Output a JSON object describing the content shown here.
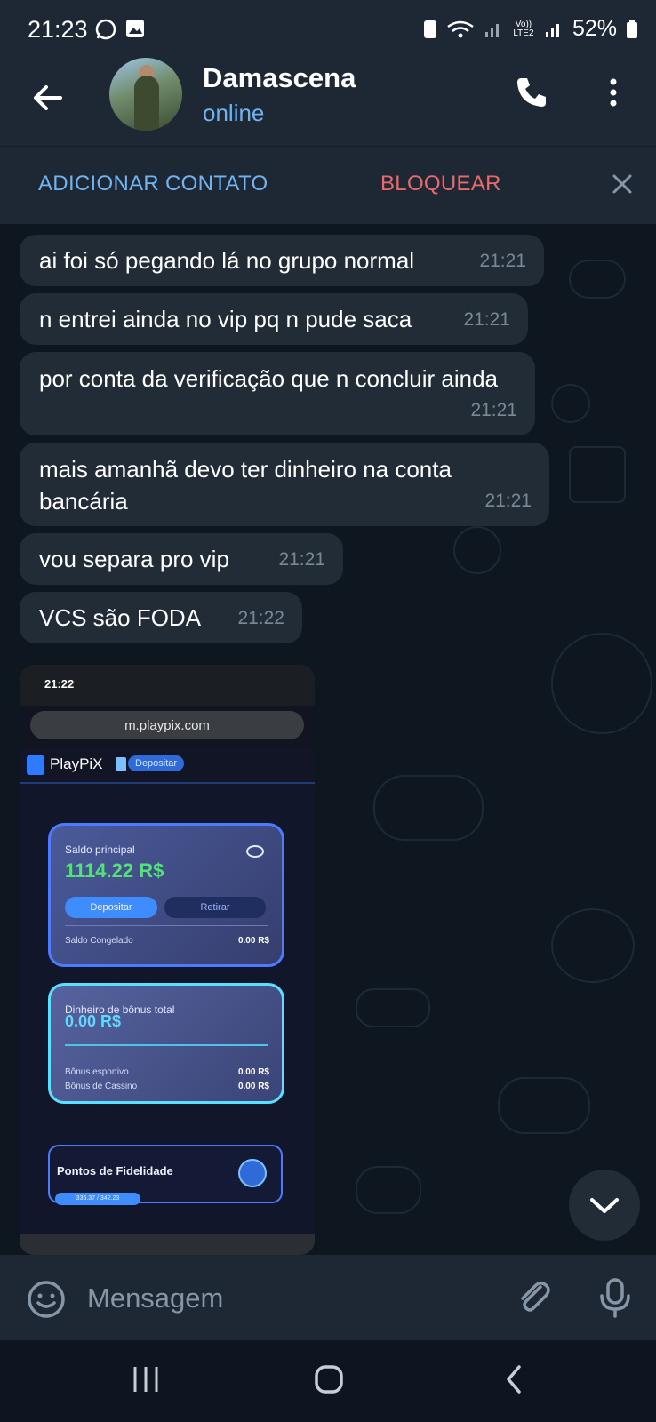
{
  "status_bar": {
    "time": "21:23",
    "battery": "52%",
    "network_label": "Vo)) LTE2"
  },
  "header": {
    "name": "Damascena",
    "status": "online"
  },
  "actions": {
    "add_contact": "ADICIONAR CONTATO",
    "block": "BLOQUEAR"
  },
  "messages": [
    {
      "text": "ai foi só pegando  lá no grupo normal",
      "time": "21:21"
    },
    {
      "text": "n entrei ainda no vip pq n pude saca",
      "time": "21:21"
    },
    {
      "text": "por conta da verificação que n concluir ainda",
      "time": "21:21"
    },
    {
      "text": "mais amanhã devo ter dinheiro na conta bancária",
      "time": "21:21"
    },
    {
      "text": "vou separa pro vip",
      "time": "21:21"
    },
    {
      "text": "VCS são FODA",
      "time": "21:22"
    }
  ],
  "screenshot": {
    "time": "21:22",
    "url": "m.playpix.com",
    "brand": "PlayPiX",
    "deposit_chip": "Depositar",
    "main_label": "Saldo principal",
    "main_amount": "1114.22 R$",
    "deposit_btn": "Depositar",
    "withdraw_btn": "Retirar",
    "frozen_label": "Saldo Congelado",
    "frozen_value": "0.00 R$",
    "bonus_label": "Dinheiro de bônus total",
    "bonus_amount": "0.00 R$",
    "sports_label": "Bônus esportivo",
    "sports_value": "0.00 R$",
    "casino_label": "Bônus de Cassino",
    "casino_value": "0.00 R$",
    "loyalty_label": "Pontos de Fidelidade",
    "loyalty_progress": "336.37 / 342.23"
  },
  "composer": {
    "placeholder": "Mensagem"
  },
  "colors": {
    "accent_blue": "#6fb3f0",
    "danger_red": "#e86a6a",
    "bubble": "#222c36",
    "bar": "#1e2835"
  }
}
